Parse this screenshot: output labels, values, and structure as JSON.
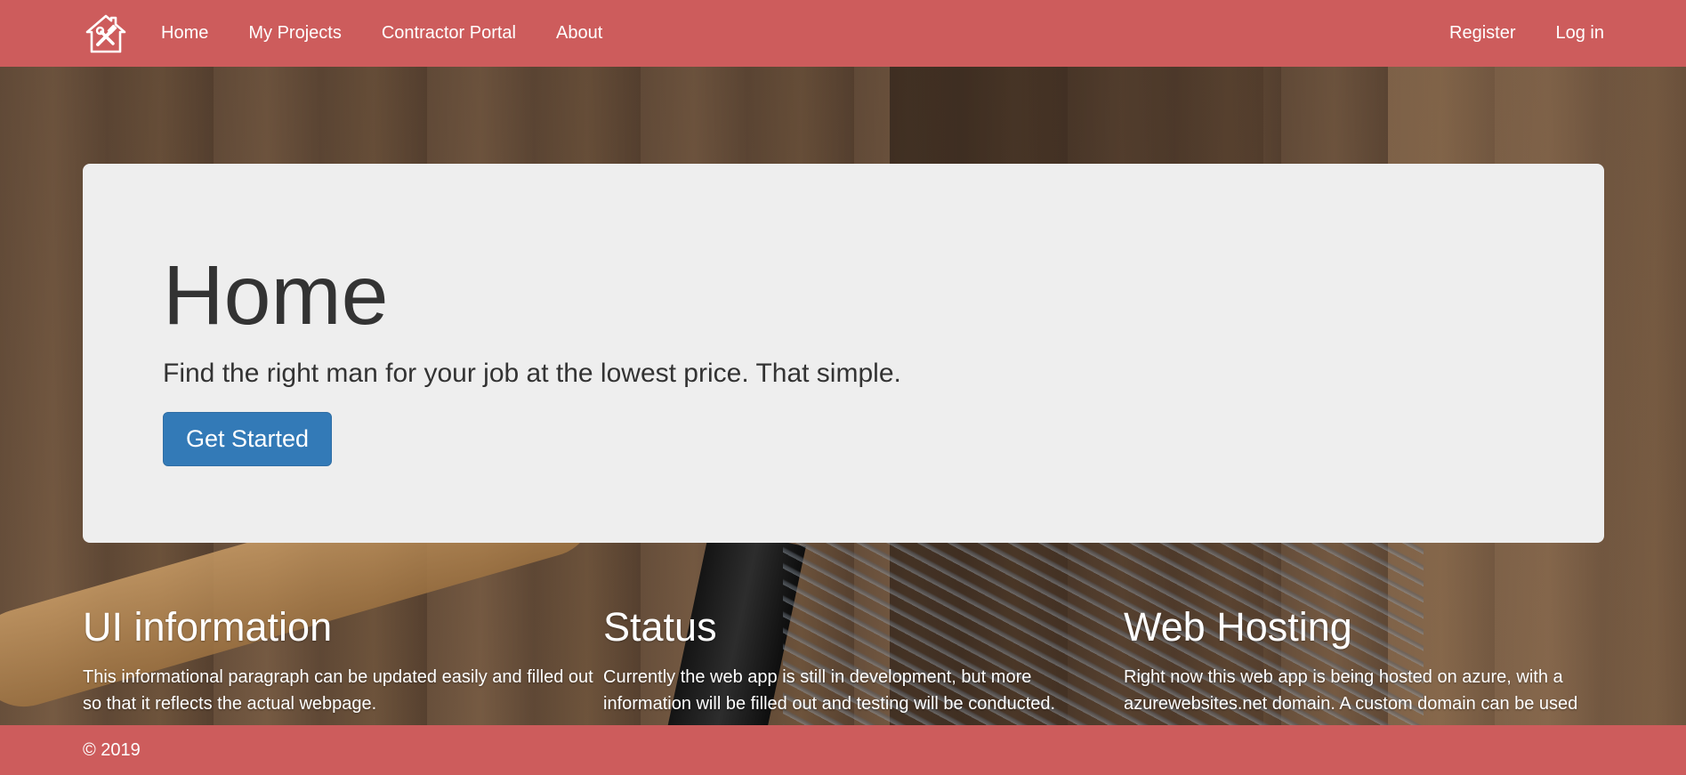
{
  "navbar": {
    "brand_icon": "house-tools-icon",
    "links": [
      {
        "label": "Home"
      },
      {
        "label": "My Projects"
      },
      {
        "label": "Contractor Portal"
      },
      {
        "label": "About"
      }
    ],
    "right_links": [
      {
        "label": "Register"
      },
      {
        "label": "Log in"
      }
    ],
    "color": "#cd5c5c"
  },
  "jumbotron": {
    "title": "Home",
    "lead": "Find the right man for your job at the lowest price. That simple.",
    "button_label": "Get Started",
    "button_color": "#337ab7"
  },
  "columns": [
    {
      "heading": "UI information",
      "text": "This informational paragraph can be updated easily and filled out so that it reflects the actual webpage."
    },
    {
      "heading": "Status",
      "text": "Currently the web app is still in development, but more information will be filled out and testing will be conducted."
    },
    {
      "heading": "Web Hosting",
      "text": "Right now this web app is being hosted on azure, with a azurewebsites.net domain. A custom domain can be used"
    }
  ],
  "footer": {
    "text": "© 2019"
  }
}
